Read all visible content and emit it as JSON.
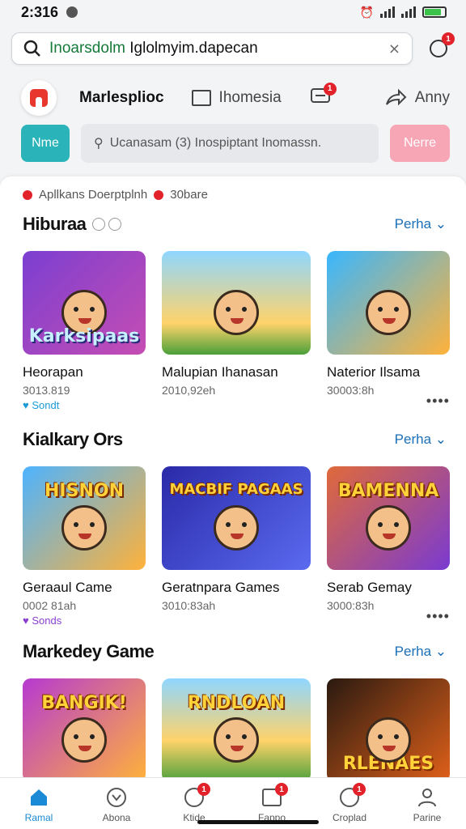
{
  "status": {
    "time": "2:316",
    "battery_level": 0.85
  },
  "search": {
    "prefix": "Inoarsdolm",
    "query": " Iglolmyim.dapecan",
    "notif_count": "1"
  },
  "nav": {
    "title": "Marlesplioc",
    "item1": "Ihomesia",
    "item1_badge": "1",
    "item2": "Anny"
  },
  "actions": {
    "left_button": "Nme",
    "filter_text": "Ucanasam (3) Inospiptant Inomassn.",
    "right_button": "Nerre"
  },
  "breadcrumbs": {
    "a": "Apllkans Doerptplnh",
    "b": "30bare"
  },
  "sections": [
    {
      "title": "Hiburaa",
      "more": "Perha",
      "cards": [
        {
          "name": "Heorapan",
          "meta": "3013.819",
          "tag": "Sondt",
          "tag_color": "#1b9ad6",
          "caption": "Karksipaas",
          "bg": "linear-gradient(135deg,#7b3fd1,#c64db3)"
        },
        {
          "name": "Malupian Ihanasan",
          "meta": "2010,92eh",
          "tag": "",
          "caption": "",
          "bg": "linear-gradient(180deg,#8fd6ff,#ffd36a 70%,#4aa03a)"
        },
        {
          "name": "Naterior Ilsama",
          "meta": "30003:8h",
          "tag": "",
          "caption": "",
          "bg": "linear-gradient(135deg,#38b6ff,#ffb23a)"
        }
      ]
    },
    {
      "title": "Kialkary Ors",
      "more": "Perha",
      "cards": [
        {
          "name": "Geraaul Came",
          "meta": "0002 81ah",
          "tag": "Sonds",
          "tag_color": "#8b3fd1",
          "caption": "HISNON",
          "bg": "linear-gradient(135deg,#4db3ff,#ffb23a)"
        },
        {
          "name": "Geratnpara Games",
          "meta": "3010:83ah",
          "tag": "",
          "caption": "MACBIF PAGAAS",
          "bg": "linear-gradient(135deg,#2a2aa8,#5a6af0)"
        },
        {
          "name": "Serab Gemay",
          "meta": "3000:83h",
          "tag": "",
          "caption": "BAMENNA",
          "bg": "linear-gradient(135deg,#e06a3a,#7a3ad1)"
        }
      ]
    },
    {
      "title": "Markedey Game",
      "more": "Perha",
      "cards": [
        {
          "caption": "BANGIK!",
          "bg": "linear-gradient(135deg,#b63ad1,#ffb23a)"
        },
        {
          "caption": "RNDLOAN",
          "bg": "linear-gradient(180deg,#8fd6ff,#ffd36a 60%,#4aa03a)"
        },
        {
          "caption": "RLENAES",
          "bg": "linear-gradient(135deg,#2a1a10,#e0601a)"
        }
      ]
    }
  ],
  "bottom_nav": [
    {
      "label": "Ramal",
      "badge": ""
    },
    {
      "label": "Abona",
      "badge": ""
    },
    {
      "label": "Ktide",
      "badge": "1"
    },
    {
      "label": "Fappo",
      "badge": "1"
    },
    {
      "label": "Croplad",
      "badge": "1"
    },
    {
      "label": "Parine",
      "badge": ""
    }
  ]
}
